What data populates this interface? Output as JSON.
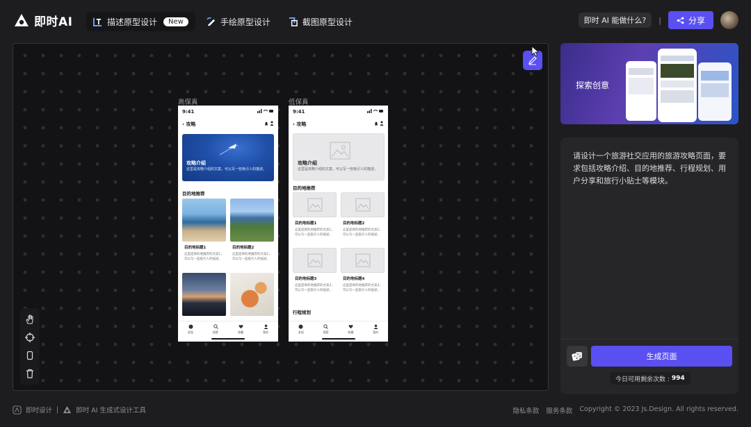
{
  "app": {
    "name": "即时AI"
  },
  "tabs": [
    {
      "label": "描述原型设计",
      "badge": "New"
    },
    {
      "label": "手绘原型设计"
    },
    {
      "label": "截图原型设计"
    }
  ],
  "header": {
    "ask_label": "即时 AI 能做什么?",
    "separator": "|",
    "share_label": "分享"
  },
  "canvas": {
    "hifi_label": "高保真",
    "lofi_label": "低保真",
    "hifi": {
      "time": "9:41",
      "title": "攻略",
      "hero_title": "攻略介绍",
      "hero_desc": "这里是攻略介绍的文案，可以写一些吸引人的描述。",
      "section": "目的地推荐",
      "cards": [
        {
          "title": "目的地标题1",
          "desc": "这里是目的地推荐的文案1，可以写一些吸引人的描述。"
        },
        {
          "title": "目的地标题2",
          "desc": "这里是目的地推荐的文案2，可以写一些吸引人的描述。"
        }
      ],
      "tabbar": [
        "发现",
        "搜索",
        "收藏",
        "我的"
      ]
    },
    "lofi": {
      "time": "9:41",
      "title": "攻略",
      "hero_title": "攻略介绍",
      "hero_desc": "这里是攻略介绍的文案，可以写一些吸引人的描述。",
      "section": "目的地推荐",
      "section2": "行程规划",
      "cards": [
        {
          "title": "目的地标题1",
          "desc": "这里是目的地推荐的文案1，可以写一些吸引人的描述。"
        },
        {
          "title": "目的地标题2",
          "desc": "这里是目的地推荐的文案2，可以写一些吸引人的描述。"
        },
        {
          "title": "目的地标题3",
          "desc": "这里是目的地推荐的文案3，可以写一些吸引人的描述。"
        },
        {
          "title": "目的地标题4",
          "desc": "这里是目的地推荐的文案4，可以写一些吸引人的描述。"
        }
      ],
      "tabbar": [
        "发现",
        "搜索",
        "收藏",
        "我的"
      ]
    }
  },
  "sidebar": {
    "banner_label": "探索创意",
    "prompt": "请设计一个旅游社交应用的旅游攻略页面，要求包括攻略介绍、目的地推荐、行程规划、用户分享和旅行小贴士等模块。",
    "generate_label": "生成页面",
    "quota_label": "今日可用剩余次数 :",
    "quota_value": "994"
  },
  "footer": {
    "brand": "即时设计",
    "separator": "|",
    "tool": "即时 AI 生成式设计工具",
    "links": [
      "隐私条款",
      "服务条款"
    ],
    "copyright": "Copyright © 2023 Js.Design. All rights reserved."
  },
  "colors": {
    "accent": "#5a4ff0",
    "background": "#1d1d20",
    "canvas": "#131315"
  }
}
